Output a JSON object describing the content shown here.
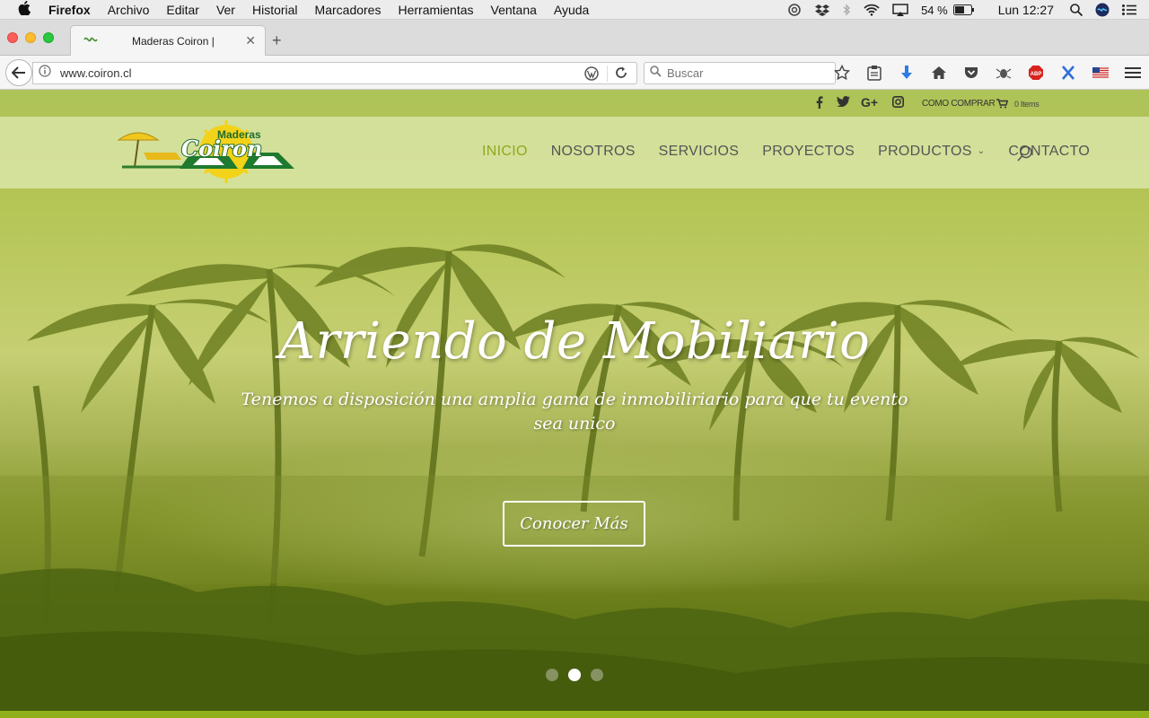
{
  "menubar": {
    "app": "Firefox",
    "items": [
      "Archivo",
      "Editar",
      "Ver",
      "Historial",
      "Marcadores",
      "Herramientas",
      "Ventana",
      "Ayuda"
    ],
    "battery": "54 %",
    "clock": "Lun 12:27"
  },
  "tab": {
    "title": "Maderas Coiron |"
  },
  "navbar": {
    "url": "www.coiron.cl",
    "search_placeholder": "Buscar"
  },
  "site": {
    "topbar": {
      "como_comprar": "COMO COMPRAR",
      "items": "0 Items"
    },
    "logo": {
      "top": "Maderas",
      "main": "Coiron"
    },
    "nav": {
      "inicio": "INICIO",
      "nosotros": "NOSOTROS",
      "servicios": "SERVICIOS",
      "proyectos": "PROYECTOS",
      "productos": "PRODUCTOS",
      "contacto": "CONTACTO"
    },
    "hero": {
      "title": "Arriendo de Mobiliario",
      "subtitle": "Tenemos a disposición una amplia gama de inmobiliriario para que tu evento sea unico",
      "button": "Conocer Más",
      "slides": 3,
      "active_slide": 2
    }
  },
  "colors": {
    "accent": "#8fa81f",
    "overlay": "#a9bc49"
  }
}
